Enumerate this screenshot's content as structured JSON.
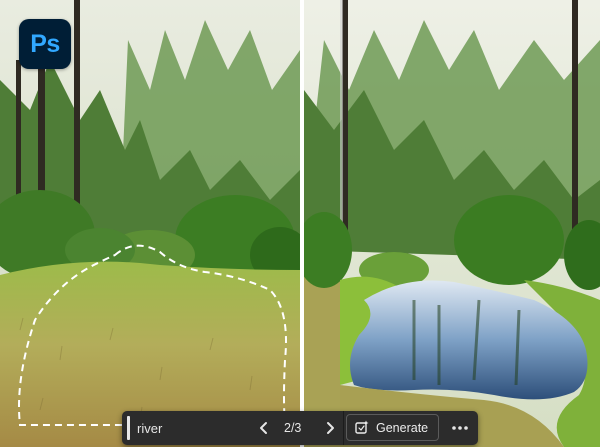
{
  "app": {
    "icon": "photoshop-icon",
    "logo_text": "Ps",
    "logo_color": "#001e36",
    "logo_text_color": "#31a8ff"
  },
  "canvas": {
    "left_image": "meadow-forest-with-dashed-lasso-selection",
    "right_image": "forest-with-generated-river",
    "selection_style": "dashed-white"
  },
  "toolbar": {
    "prompt_value": "river",
    "prev_icon": "chevron-left-icon",
    "counter": "2/3",
    "next_icon": "chevron-right-icon",
    "generate_icon": "generative-fill-icon",
    "generate_label": "Generate",
    "more_icon": "more-horizontal-icon",
    "background": "#2c2c2c"
  }
}
